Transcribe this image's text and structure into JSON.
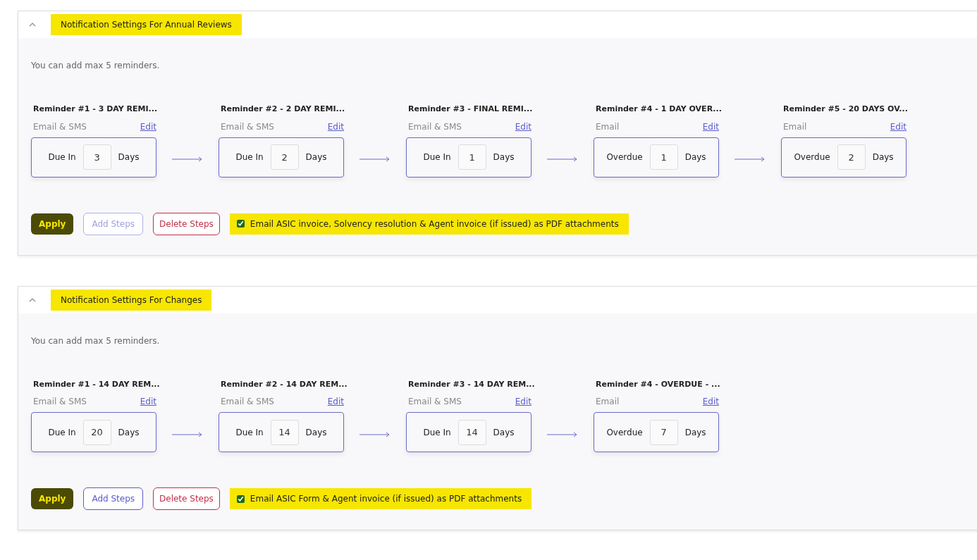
{
  "panels": [
    {
      "title": "Notification Settings For Annual Reviews",
      "title_highlighted": true,
      "expanded": true,
      "note": "You can add max 5 reminders.",
      "reminders": [
        {
          "title": "Reminder #1 - 3 DAY REMI...",
          "channel": "Email & SMS",
          "edit": "Edit",
          "timing": "Due In",
          "days_value": "3",
          "unit": "Days"
        },
        {
          "title": "Reminder #2 - 2 DAY REMI...",
          "channel": "Email & SMS",
          "edit": "Edit",
          "timing": "Due In",
          "days_value": "2",
          "unit": "Days"
        },
        {
          "title": "Reminder #3 - FINAL REMI...",
          "channel": "Email & SMS",
          "edit": "Edit",
          "timing": "Due In",
          "days_value": "1",
          "unit": "Days"
        },
        {
          "title": "Reminder #4 - 1 DAY OVER...",
          "channel": "Email",
          "edit": "Edit",
          "timing": "Overdue",
          "days_value": "1",
          "unit": "Days"
        },
        {
          "title": "Reminder #5 - 20 DAYS OV...",
          "channel": "Email",
          "edit": "Edit",
          "timing": "Overdue",
          "days_value": "2",
          "unit": "Days"
        }
      ],
      "apply": {
        "label": "Apply",
        "highlighted": true
      },
      "add_steps": {
        "label": "Add Steps",
        "disabled": true
      },
      "delete_steps": {
        "label": "Delete Steps"
      },
      "attachment": {
        "label": "Email ASIC invoice, Solvency resolution & Agent invoice (if issued) as PDF attachments",
        "checked": true,
        "highlighted": true
      }
    },
    {
      "title": "Notification Settings For Changes",
      "title_highlighted": true,
      "expanded": true,
      "note": "You can add max 5 reminders.",
      "reminders": [
        {
          "title": "Reminder #1 - 14 DAY REM...",
          "channel": "Email & SMS",
          "edit": "Edit",
          "timing": "Due In",
          "days_value": "20",
          "unit": "Days"
        },
        {
          "title": "Reminder #2 - 14 DAY REM...",
          "channel": "Email & SMS",
          "edit": "Edit",
          "timing": "Due In",
          "days_value": "14",
          "unit": "Days"
        },
        {
          "title": "Reminder #3 - 14 DAY REM...",
          "channel": "Email & SMS",
          "edit": "Edit",
          "timing": "Due In",
          "days_value": "14",
          "unit": "Days"
        },
        {
          "title": "Reminder #4 - OVERDUE - ...",
          "channel": "Email",
          "edit": "Edit",
          "timing": "Overdue",
          "days_value": "7",
          "unit": "Days"
        }
      ],
      "apply": {
        "label": "Apply",
        "highlighted": true
      },
      "add_steps": {
        "label": "Add Steps",
        "disabled": false
      },
      "delete_steps": {
        "label": "Delete Steps"
      },
      "attachment": {
        "label": "Email ASIC Form & Agent invoice (if issued) as PDF attachments",
        "checked": true,
        "highlighted": true
      }
    }
  ]
}
